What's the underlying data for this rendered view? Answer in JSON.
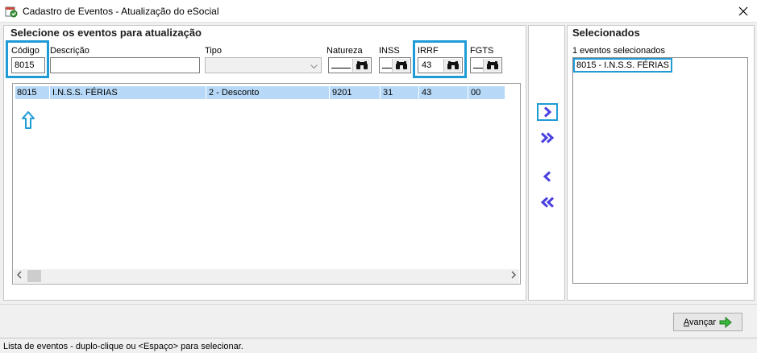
{
  "window": {
    "title": "Cadastro de Eventos - Atualização do eSocial",
    "icon": "app-calendar-icon",
    "close_icon": "close-icon"
  },
  "left": {
    "section_title": "Selecione os eventos para atualização",
    "fields": {
      "codigo_label": "Código",
      "codigo_value": "8015",
      "descricao_label": "Descrição",
      "descricao_value": "",
      "tipo_label": "Tipo",
      "tipo_value": "",
      "natureza_label": "Natureza",
      "natureza_value": "",
      "inss_label": "INSS",
      "inss_value": "",
      "irrf_label": "IRRF",
      "irrf_value": "43",
      "fgts_label": "FGTS",
      "fgts_value": ""
    },
    "grid": {
      "rows": [
        {
          "codigo": "8015",
          "descricao": "I.N.S.S. FÉRIAS",
          "tipo": "2 - Desconto",
          "natureza": "9201",
          "inss": "31",
          "irrf": "43",
          "fgts": "00"
        }
      ],
      "annotation_icon": "arrow-up-outline-icon"
    }
  },
  "transfer": {
    "add_one_icon": "chevron-right-icon",
    "add_all_icon": "double-chevron-right-icon",
    "remove_one_icon": "chevron-left-icon",
    "remove_all_icon": "double-chevron-left-icon",
    "accent_color": "#4a3fe0"
  },
  "right": {
    "section_title": "Selecionados",
    "count_text": "1 eventos selecionados",
    "items": [
      "8015 - I.N.S.S. FÉRIAS"
    ]
  },
  "footer": {
    "next_button_label": "Avançar",
    "next_icon": "green-arrow-right-icon"
  },
  "status": {
    "text": "Lista de eventos - duplo-clique ou <Espaço> para selecionar."
  },
  "colors": {
    "highlight": "#1f9bd6",
    "selected_row": "#b7d9f7"
  }
}
